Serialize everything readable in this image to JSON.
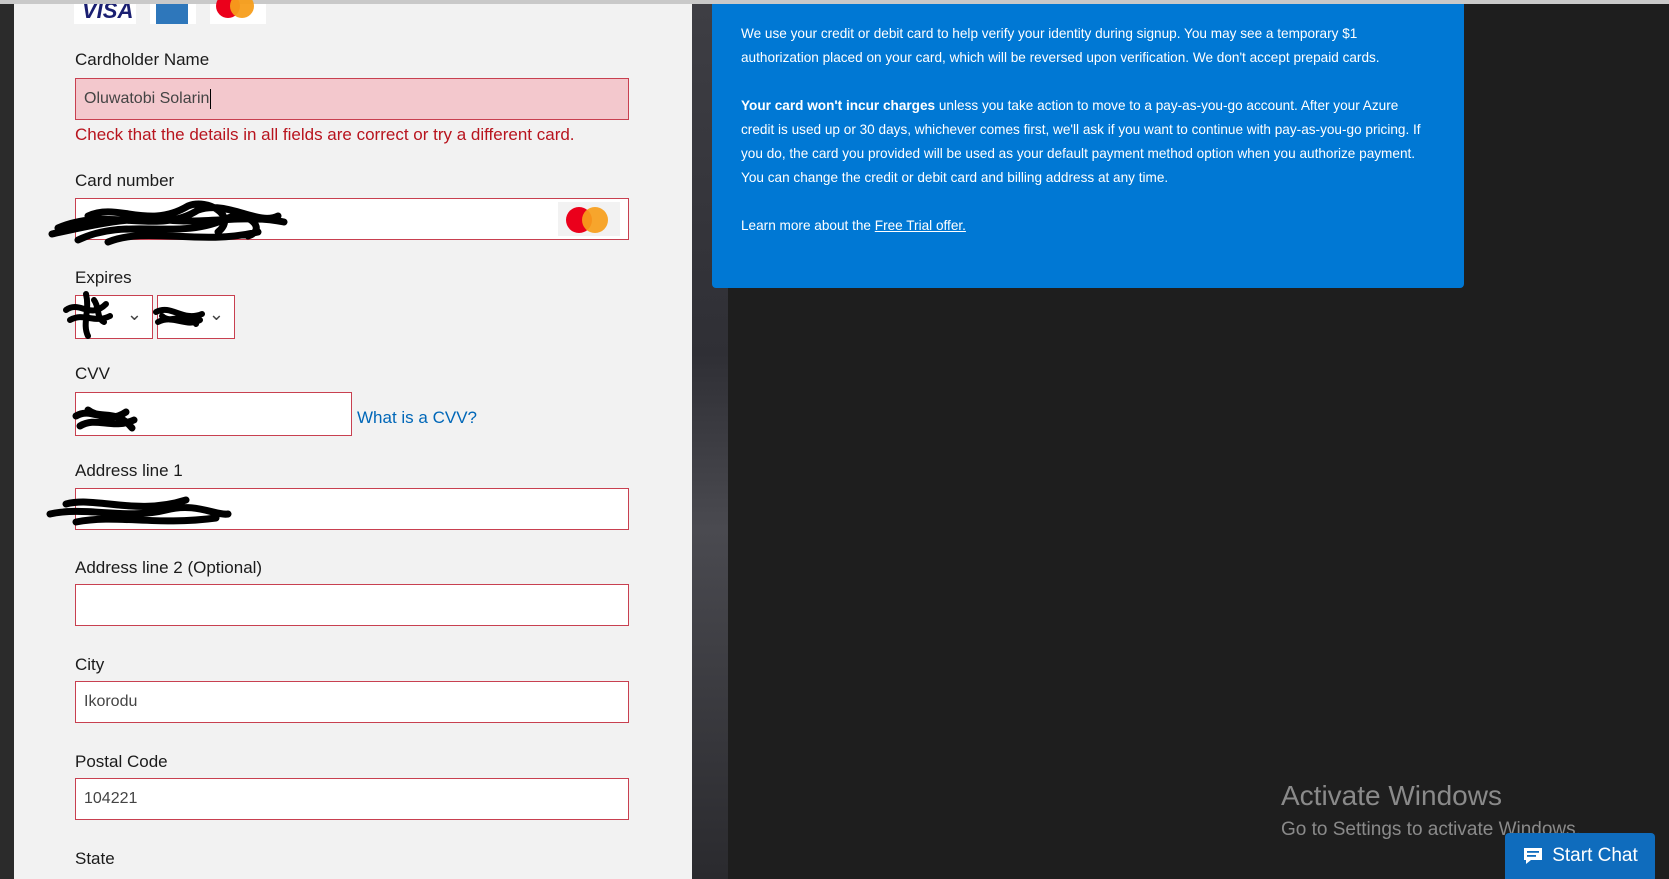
{
  "form": {
    "card_logos": [
      "VISA",
      "AMERICAN EXPRESS",
      "mastercard"
    ],
    "cardholder_label": "Cardholder Name",
    "cardholder_value": "Oluwatobi Solarin",
    "error_message": "Check that the details in all fields are correct or try a different card.",
    "card_number_label": "Card number",
    "expires_label": "Expires",
    "cvv_label": "CVV",
    "cvv_link": "What is a CVV?",
    "address1_label": "Address line 1",
    "address2_label": "Address line 2 (Optional)",
    "address2_value": "",
    "city_label": "City",
    "city_value": "Ikorodu",
    "postal_label": "Postal Code",
    "postal_value": "104221",
    "state_label": "State"
  },
  "info": {
    "p1": "We use your credit or debit card to help verify your identity during signup. You may see a temporary $1 authorization placed on your card, which will be reversed upon verification. We don't accept prepaid cards.",
    "p2_bold": "Your card won't incur charges",
    "p2_rest": " unless you take action to move to a pay-as-you-go account. After your Azure credit is used up or 30 days, whichever comes first, we'll ask if you want to continue with pay-as-you-go pricing. If you do, the card you provided will be used as your default payment method option when you authorize payment. You can change the credit or debit card and billing address at any time.",
    "p3_prefix": "Learn more about the ",
    "p3_link": "Free Trial offer."
  },
  "watermark": {
    "title": "Activate Windows",
    "subtitle": "Go to Settings to activate Windows."
  },
  "chat": {
    "label": "Start Chat"
  },
  "colors": {
    "accent": "#0078d4",
    "error": "#b8141e",
    "field_border": "#c84050"
  }
}
